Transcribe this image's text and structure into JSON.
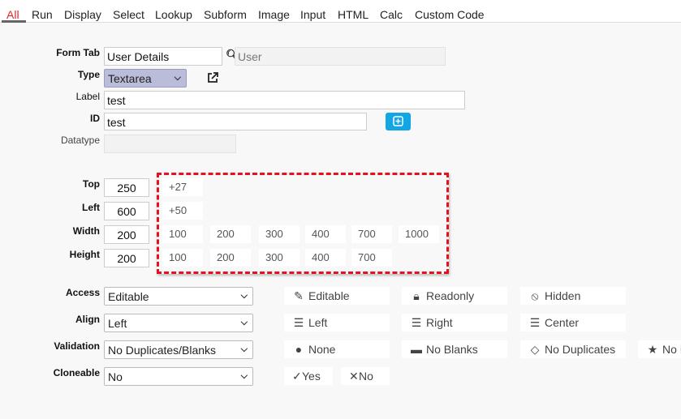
{
  "tabs": [
    "All",
    "Run",
    "Display",
    "Select",
    "Lookup",
    "Subform",
    "Image",
    "Input",
    "HTML",
    "Calc",
    "Custom Code"
  ],
  "active_tab": "All",
  "accent_color": "#e8202a",
  "form": {
    "form_tab_label": "Form Tab",
    "form_tab_value": "User Details",
    "search_value": "User",
    "type_label": "Type",
    "type_value": "Textarea",
    "label_label": "Label",
    "label_value": "test",
    "id_label": "ID",
    "id_value": "test",
    "datatype_label": "Datatype",
    "datatype_value": ""
  },
  "position": {
    "top_label": "Top",
    "top_value": "250",
    "top_quick": [
      "+27"
    ],
    "left_label": "Left",
    "left_value": "600",
    "left_quick": [
      "+50"
    ],
    "width_label": "Width",
    "width_value": "200",
    "width_quick": [
      "100",
      "200",
      "300",
      "400",
      "700",
      "1000"
    ],
    "height_label": "Height",
    "height_value": "200",
    "height_quick": [
      "100",
      "200",
      "300",
      "400",
      "700"
    ]
  },
  "options": {
    "access": {
      "label": "Access",
      "value": "Editable",
      "buttons": [
        {
          "icon": "edit-icon",
          "text": "Editable"
        },
        {
          "icon": "lock-icon",
          "text": "Readonly"
        },
        {
          "icon": "eye-slash-icon",
          "text": "Hidden"
        }
      ]
    },
    "align": {
      "label": "Align",
      "value": "Left",
      "buttons": [
        {
          "icon": "align-left-icon",
          "text": "Left"
        },
        {
          "icon": "align-right-icon",
          "text": "Right"
        },
        {
          "icon": "align-center-icon",
          "text": "Center"
        }
      ]
    },
    "validation": {
      "label": "Validation",
      "value": "No Duplicates/Blanks",
      "buttons": [
        {
          "icon": "globe-icon",
          "text": "None"
        },
        {
          "icon": "battery-icon",
          "text": "No Blanks"
        },
        {
          "icon": "diamond-icon",
          "text": "No Duplicates"
        },
        {
          "icon": "star-icon",
          "text": "No D"
        }
      ]
    },
    "cloneable": {
      "label": "Cloneable",
      "value": "No",
      "buttons": [
        {
          "icon": "check-icon",
          "text": "Yes"
        },
        {
          "icon": "x-icon",
          "text": "No"
        }
      ]
    }
  }
}
